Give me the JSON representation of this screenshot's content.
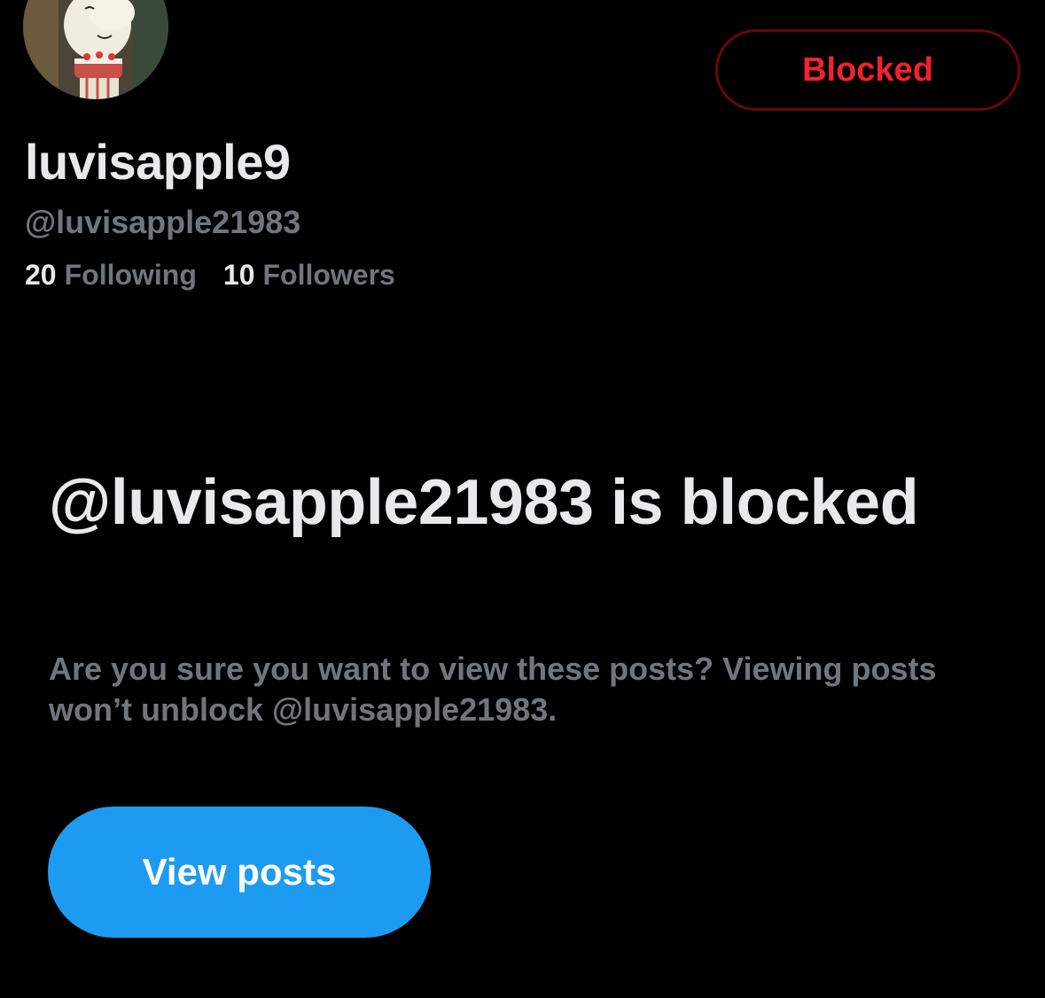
{
  "profile": {
    "display_name": "luvisapple9",
    "handle": "@luvisapple21983",
    "following_count": "20",
    "following_label": "Following",
    "followers_count": "10",
    "followers_label": "Followers",
    "avatar_icon": "avatar-cartoon-character-with-cake"
  },
  "actions": {
    "blocked_label": "Blocked",
    "view_posts_label": "View posts"
  },
  "blocked_notice": {
    "title": "@luvisapple21983 is blocked",
    "description": "Are you sure you want to view these posts? Viewing posts won’t unblock @luvisapple21983."
  },
  "colors": {
    "background": "#000000",
    "primary_text": "#e7e9ea",
    "secondary_text": "#71767b",
    "blocked_red": "#f4212e",
    "blocked_border": "#67070f",
    "accent_blue": "#1d9bf0"
  }
}
